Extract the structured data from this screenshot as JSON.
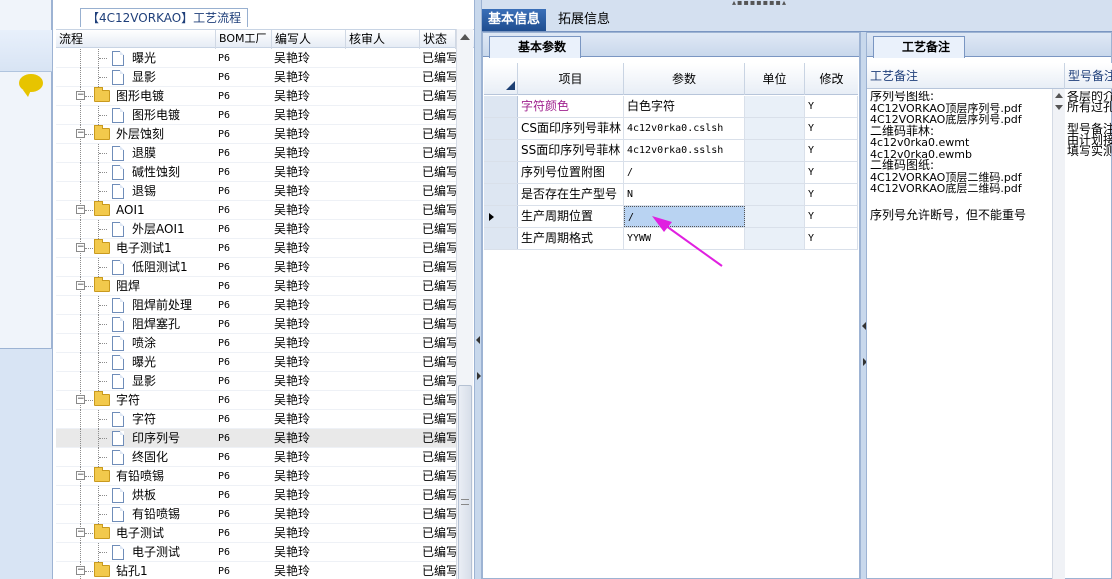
{
  "tree_panel": {
    "caption": "【4C12VORKAO】工艺流程",
    "columns": [
      "流程",
      "BOM工厂",
      "编写人",
      "核审人",
      "状态"
    ],
    "rows": [
      {
        "label": "曝光",
        "type": "doc",
        "level": 2,
        "bom": "P6",
        "author": "吴艳玲",
        "reviewer": "",
        "status": "已编写"
      },
      {
        "label": "显影",
        "type": "doc",
        "level": 2,
        "bom": "P6",
        "author": "吴艳玲",
        "reviewer": "",
        "status": "已编写"
      },
      {
        "label": "图形电镀",
        "type": "folder",
        "level": 1,
        "bom": "P6",
        "author": "吴艳玲",
        "reviewer": "",
        "status": "已编写"
      },
      {
        "label": "图形电镀",
        "type": "doc",
        "level": 2,
        "bom": "P6",
        "author": "吴艳玲",
        "reviewer": "",
        "status": "已编写"
      },
      {
        "label": "外层蚀刻",
        "type": "folder",
        "level": 1,
        "bom": "P6",
        "author": "吴艳玲",
        "reviewer": "",
        "status": "已编写"
      },
      {
        "label": "退膜",
        "type": "doc",
        "level": 2,
        "bom": "P6",
        "author": "吴艳玲",
        "reviewer": "",
        "status": "已编写"
      },
      {
        "label": "碱性蚀刻",
        "type": "doc",
        "level": 2,
        "bom": "P6",
        "author": "吴艳玲",
        "reviewer": "",
        "status": "已编写"
      },
      {
        "label": "退锡",
        "type": "doc",
        "level": 2,
        "bom": "P6",
        "author": "吴艳玲",
        "reviewer": "",
        "status": "已编写"
      },
      {
        "label": "AOI1",
        "type": "folder",
        "level": 1,
        "bom": "P6",
        "author": "吴艳玲",
        "reviewer": "",
        "status": "已编写"
      },
      {
        "label": "外层AOI1",
        "type": "doc",
        "level": 2,
        "bom": "P6",
        "author": "吴艳玲",
        "reviewer": "",
        "status": "已编写"
      },
      {
        "label": "电子测试1",
        "type": "folder",
        "level": 1,
        "bom": "P6",
        "author": "吴艳玲",
        "reviewer": "",
        "status": "已编写"
      },
      {
        "label": "低阻测试1",
        "type": "doc",
        "level": 2,
        "bom": "P6",
        "author": "吴艳玲",
        "reviewer": "",
        "status": "已编写"
      },
      {
        "label": "阻焊",
        "type": "folder",
        "level": 1,
        "bom": "P6",
        "author": "吴艳玲",
        "reviewer": "",
        "status": "已编写"
      },
      {
        "label": "阻焊前处理",
        "type": "doc",
        "level": 2,
        "bom": "P6",
        "author": "吴艳玲",
        "reviewer": "",
        "status": "已编写"
      },
      {
        "label": "阻焊塞孔",
        "type": "doc",
        "level": 2,
        "bom": "P6",
        "author": "吴艳玲",
        "reviewer": "",
        "status": "已编写"
      },
      {
        "label": "喷涂",
        "type": "doc",
        "level": 2,
        "bom": "P6",
        "author": "吴艳玲",
        "reviewer": "",
        "status": "已编写"
      },
      {
        "label": "曝光",
        "type": "doc",
        "level": 2,
        "bom": "P6",
        "author": "吴艳玲",
        "reviewer": "",
        "status": "已编写"
      },
      {
        "label": "显影",
        "type": "doc",
        "level": 2,
        "bom": "P6",
        "author": "吴艳玲",
        "reviewer": "",
        "status": "已编写"
      },
      {
        "label": "字符",
        "type": "folder",
        "level": 1,
        "bom": "P6",
        "author": "吴艳玲",
        "reviewer": "",
        "status": "已编写"
      },
      {
        "label": "字符",
        "type": "doc",
        "level": 2,
        "bom": "P6",
        "author": "吴艳玲",
        "reviewer": "",
        "status": "已编写"
      },
      {
        "label": "印序列号",
        "type": "doc",
        "level": 2,
        "bom": "P6",
        "author": "吴艳玲",
        "reviewer": "",
        "status": "已编写",
        "selected": true
      },
      {
        "label": "终固化",
        "type": "doc",
        "level": 2,
        "bom": "P6",
        "author": "吴艳玲",
        "reviewer": "",
        "status": "已编写"
      },
      {
        "label": "有铅喷锡",
        "type": "folder",
        "level": 1,
        "bom": "P6",
        "author": "吴艳玲",
        "reviewer": "",
        "status": "已编写"
      },
      {
        "label": "烘板",
        "type": "doc",
        "level": 2,
        "bom": "P6",
        "author": "吴艳玲",
        "reviewer": "",
        "status": "已编写"
      },
      {
        "label": "有铅喷锡",
        "type": "doc",
        "level": 2,
        "bom": "P6",
        "author": "吴艳玲",
        "reviewer": "",
        "status": "已编写"
      },
      {
        "label": "电子测试",
        "type": "folder",
        "level": 1,
        "bom": "P6",
        "author": "吴艳玲",
        "reviewer": "",
        "status": "已编写"
      },
      {
        "label": "电子测试",
        "type": "doc",
        "level": 2,
        "bom": "P6",
        "author": "吴艳玲",
        "reviewer": "",
        "status": "已编写"
      },
      {
        "label": "钻孔1",
        "type": "folder",
        "level": 1,
        "bom": "P6",
        "author": "吴艳玲",
        "reviewer": "",
        "status": "已编写"
      }
    ]
  },
  "main_tabs": [
    "基本信息",
    "拓展信息"
  ],
  "param_panel": {
    "tab": "基本参数",
    "columns": [
      "项目",
      "参数",
      "单位",
      "修改"
    ],
    "rows": [
      {
        "item": "字符颜色",
        "param": "白色字符",
        "unit": "",
        "modify": "Y",
        "item_color": "#a0238f"
      },
      {
        "item": "CS面印序列号菲林",
        "param": "4c12v0rka0.cslsh",
        "unit": "",
        "modify": "Y"
      },
      {
        "item": "SS面印序列号菲林",
        "param": "4c12v0rka0.sslsh",
        "unit": "",
        "modify": "Y"
      },
      {
        "item": "序列号位置附图",
        "param": "/",
        "unit": "",
        "modify": "Y"
      },
      {
        "item": "是否存在生产型号",
        "param": "N",
        "unit": "",
        "modify": "Y"
      },
      {
        "item": "生产周期位置",
        "param": "/",
        "unit": "",
        "modify": "Y",
        "current": true
      },
      {
        "item": "生产周期格式",
        "param": "YYWW",
        "unit": "",
        "modify": "Y"
      }
    ]
  },
  "remark_panel": {
    "tab": "工艺备注",
    "columns": [
      "工艺备注",
      "型号备注"
    ],
    "process_note_lines": [
      "序列号图纸:",
      "4C12VORKAO顶层序列号.pdf",
      "4C12VORKAO底层序列号.pdf",
      "二维码菲林:",
      "4c12v0rka0.ewmt",
      "4c12v0rka0.ewmb",
      "二维码图纸:",
      "4C12VORKAO顶层二维码.pdf",
      "4C12VORKAO底层二维码.pdf",
      "",
      "序列号允许断号，但不能重号"
    ],
    "model_note_lines": [
      "各层的介",
      "所有过孔",
      "",
      "型号备注",
      "由计划接",
      "填写实测"
    ]
  },
  "colors": {
    "accent_tab": "#1f4d8f",
    "annotation_arrow": "#e020e0",
    "highlight": "#b9d3f2"
  }
}
